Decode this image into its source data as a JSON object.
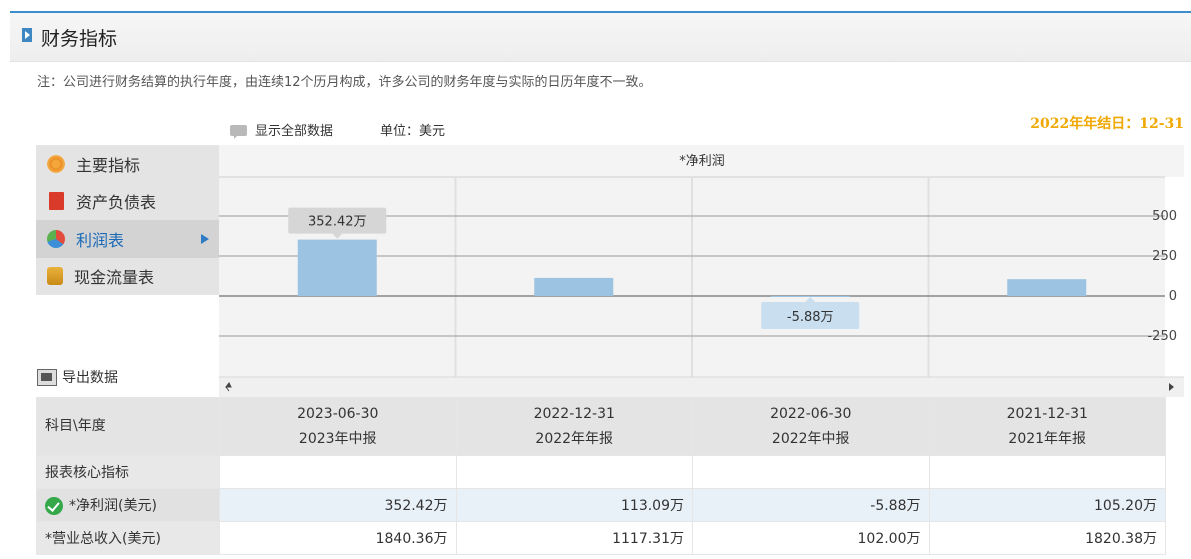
{
  "header": {
    "title": "财务指标"
  },
  "note": "注：公司进行财务结算的执行年度，由连续12个历月构成，许多公司的财务年度与实际的日历年度不一致。",
  "toolbar": {
    "show_all": "显示全部数据",
    "unit": "单位：美元",
    "year_end": "2022年年结日：12-31"
  },
  "menu": {
    "items": [
      {
        "label": "主要指标",
        "icon": "flower-icon",
        "active": false
      },
      {
        "label": "资产负债表",
        "icon": "document-icon",
        "active": false
      },
      {
        "label": "利润表",
        "icon": "pie-chart-icon",
        "active": true
      },
      {
        "label": "现金流量表",
        "icon": "coins-icon",
        "active": false
      }
    ]
  },
  "export_label": "导出数据",
  "chart_data": {
    "type": "bar",
    "title": "*净利润",
    "categories": [
      "2023-06-30",
      "2022-12-31",
      "2022-06-30",
      "2021-12-31"
    ],
    "values": [
      352.42,
      113.09,
      -5.88,
      105.2
    ],
    "value_labels": [
      "352.42万",
      "-5.88万"
    ],
    "yticks": [
      500,
      250,
      0,
      -250
    ],
    "ylim": [
      -400,
      750
    ],
    "grid": true,
    "bar_color": "#9cc3e1"
  },
  "table": {
    "corner_label": "科目\\年度",
    "periods": [
      {
        "date": "2023-06-30",
        "report": "2023年中报"
      },
      {
        "date": "2022-12-31",
        "report": "2022年年报"
      },
      {
        "date": "2022-06-30",
        "report": "2022年中报"
      },
      {
        "date": "2021-12-31",
        "report": "2021年年报"
      }
    ],
    "core_label": "报表核心指标",
    "net_profit": {
      "label": "*净利润(美元)",
      "values": [
        "352.42万",
        "113.09万",
        "-5.88万",
        "105.20万"
      ]
    },
    "revenue": {
      "label": "*营业总收入(美元)",
      "values": [
        "1840.36万",
        "1117.31万",
        "102.00万",
        "1820.38万"
      ]
    }
  }
}
